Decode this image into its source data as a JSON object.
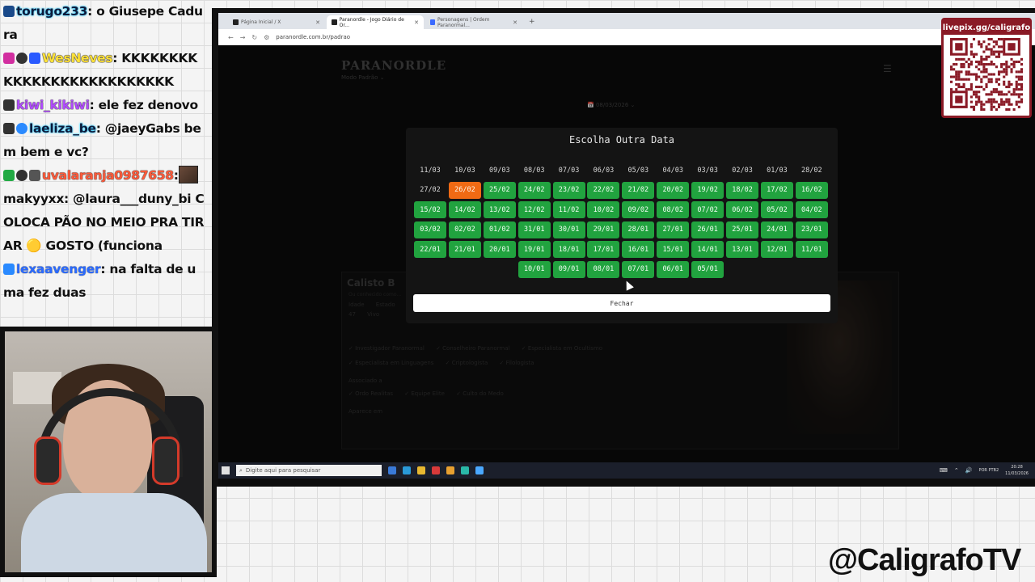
{
  "chat": [
    {
      "user": "torugo233",
      "style": "outline-cyan",
      "badges": [
        "#1a4a8a"
      ],
      "text": ": o Giusepe Cadura"
    },
    {
      "user": "WesNeves",
      "style": "outline-yellow",
      "badges": [
        "#d22fa0",
        "#333333",
        "#2a5aff"
      ],
      "text": ": KKKKKKKKKKKKKKKKKKKKKKKKKK"
    },
    {
      "user": "kiwi_kikiwi",
      "style": "outline-purple",
      "badges": [
        "#333333"
      ],
      "text": ": ele fez denovo"
    },
    {
      "user": "laeliza_be",
      "style": "outline-cyan",
      "badges": [
        "#333333",
        "#2a8aff"
      ],
      "text": ": @jaeyGabs bem bem e vc?"
    },
    {
      "user": "uvalaranja0987658",
      "style": "outline-red",
      "badges": [
        "#22aa44",
        "#333333",
        "#555555"
      ],
      "text": ":",
      "avatar": true
    },
    {
      "user": "makyyxx",
      "style": "plain",
      "badges": [],
      "text": ": @laura___duny_bi COLOCA PÃO NO MEIO PRA TIRAR 🟡 GOSTO (funciona"
    },
    {
      "user": "lexaavenger",
      "style": "outline-lexa",
      "badges": [
        "#2a8aff"
      ],
      "text": ": na falta de uma fez duas"
    }
  ],
  "browser": {
    "tabs": [
      {
        "label": "Página Inicial / X",
        "active": false
      },
      {
        "label": "Paranordle - Jogo Diário de Or...",
        "active": true
      },
      {
        "label": "Personagens | Ordem Paranormal...",
        "active": false
      }
    ],
    "new_tab": "+",
    "close_glyph": "✕",
    "url": "paranordle.com.br/padrao",
    "nav": {
      "back": "←",
      "forward": "→",
      "reload": "↻",
      "info": "⚙"
    }
  },
  "page": {
    "logo": "PARANORDLE",
    "mode": "Modo Padrão ⌄",
    "menu_icon": "☰",
    "date_selector": "📅 08/03/2026 ⌄",
    "result": {
      "name": "Calisto B",
      "subtitle": "Ou conhecido como...",
      "row1": [
        "Idade",
        "Estado",
        "47",
        "Vivo"
      ],
      "row2": [
        "✓ Investigador Paranormal",
        "✓ Conselheiro Paranormal",
        "✓ Especialista em Ocultismo"
      ],
      "row3": [
        "✓ Especialista em Linguagens",
        "✓ Criptologista",
        "✓ Filologista"
      ],
      "row4_label": "Associado a",
      "row4": [
        "✓ Ordo Realitas",
        "✓ Equipe Elite",
        "✓ Culto do Medo"
      ],
      "row5_label": "Aparece em"
    }
  },
  "modal": {
    "title": "Escolha Outra Data",
    "close_label": "Fechar",
    "dates": [
      {
        "label": "11/03",
        "state": "dark"
      },
      {
        "label": "10/03",
        "state": "dark"
      },
      {
        "label": "09/03",
        "state": "dark"
      },
      {
        "label": "08/03",
        "state": "dark"
      },
      {
        "label": "07/03",
        "state": "dark"
      },
      {
        "label": "06/03",
        "state": "dark"
      },
      {
        "label": "05/03",
        "state": "dark"
      },
      {
        "label": "04/03",
        "state": "dark"
      },
      {
        "label": "03/03",
        "state": "dark"
      },
      {
        "label": "02/03",
        "state": "dark"
      },
      {
        "label": "01/03",
        "state": "dark"
      },
      {
        "label": "28/02",
        "state": "dark"
      },
      {
        "label": "27/02",
        "state": "dark"
      },
      {
        "label": "26/02",
        "state": "orange"
      },
      {
        "label": "25/02",
        "state": "green"
      },
      {
        "label": "24/02",
        "state": "green"
      },
      {
        "label": "23/02",
        "state": "green"
      },
      {
        "label": "22/02",
        "state": "green"
      },
      {
        "label": "21/02",
        "state": "green"
      },
      {
        "label": "20/02",
        "state": "green"
      },
      {
        "label": "19/02",
        "state": "green"
      },
      {
        "label": "18/02",
        "state": "green"
      },
      {
        "label": "17/02",
        "state": "green"
      },
      {
        "label": "16/02",
        "state": "green"
      },
      {
        "label": "15/02",
        "state": "green"
      },
      {
        "label": "14/02",
        "state": "green"
      },
      {
        "label": "13/02",
        "state": "green"
      },
      {
        "label": "12/02",
        "state": "green"
      },
      {
        "label": "11/02",
        "state": "green"
      },
      {
        "label": "10/02",
        "state": "green"
      },
      {
        "label": "09/02",
        "state": "green"
      },
      {
        "label": "08/02",
        "state": "green"
      },
      {
        "label": "07/02",
        "state": "green"
      },
      {
        "label": "06/02",
        "state": "green"
      },
      {
        "label": "05/02",
        "state": "green"
      },
      {
        "label": "04/02",
        "state": "green"
      },
      {
        "label": "03/02",
        "state": "green"
      },
      {
        "label": "02/02",
        "state": "green"
      },
      {
        "label": "01/02",
        "state": "green"
      },
      {
        "label": "31/01",
        "state": "green"
      },
      {
        "label": "30/01",
        "state": "green"
      },
      {
        "label": "29/01",
        "state": "green"
      },
      {
        "label": "28/01",
        "state": "green"
      },
      {
        "label": "27/01",
        "state": "green"
      },
      {
        "label": "26/01",
        "state": "green"
      },
      {
        "label": "25/01",
        "state": "green"
      },
      {
        "label": "24/01",
        "state": "green"
      },
      {
        "label": "23/01",
        "state": "green"
      },
      {
        "label": "22/01",
        "state": "green"
      },
      {
        "label": "21/01",
        "state": "green"
      },
      {
        "label": "20/01",
        "state": "green"
      },
      {
        "label": "19/01",
        "state": "green"
      },
      {
        "label": "18/01",
        "state": "green"
      },
      {
        "label": "17/01",
        "state": "green"
      },
      {
        "label": "16/01",
        "state": "green"
      },
      {
        "label": "15/01",
        "state": "green"
      },
      {
        "label": "14/01",
        "state": "green"
      },
      {
        "label": "13/01",
        "state": "green"
      },
      {
        "label": "12/01",
        "state": "green"
      },
      {
        "label": "11/01",
        "state": "green"
      },
      {
        "label": "10/01",
        "state": "green"
      },
      {
        "label": "09/01",
        "state": "green"
      },
      {
        "label": "08/01",
        "state": "green"
      },
      {
        "label": "07/01",
        "state": "green"
      },
      {
        "label": "06/01",
        "state": "green"
      },
      {
        "label": "05/01",
        "state": "green"
      }
    ],
    "colors": {
      "green": "#21a33f",
      "orange": "#f06a14",
      "dark": "#141414"
    }
  },
  "taskbar": {
    "search_placeholder": "Digite aqui para pesquisar",
    "language": "POR PTB2",
    "time": "20:28",
    "date": "11/03/2026"
  },
  "overlay": {
    "qr_label": "livepix.gg/caligrafo",
    "channel": "@CaligrafoTV",
    "accent": "#8a1a26"
  }
}
